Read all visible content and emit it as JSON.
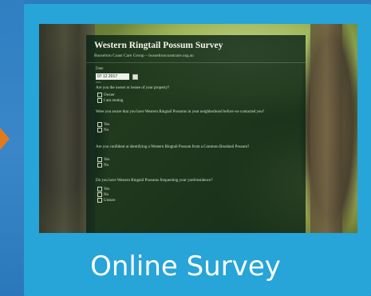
{
  "form": {
    "title": "Western Ringtail Possum Survey",
    "subtitle": "Busselton Coast Care Group – busseltoncoastcare.org.au",
    "date_label": "Date",
    "date_value": "07 12 2017",
    "date_hint": "Date",
    "questions": [
      {
        "text": "Are you the owner or lessee of your property?",
        "options": [
          "Owner",
          "I am renting"
        ]
      },
      {
        "text": "Were you aware that you have Western Ringtail Possums in your neighborhood before we contacted you?",
        "options": [
          "Yes",
          "No"
        ]
      },
      {
        "text": "Are you confident at identifying a Western Ringtail Possum from a Common Brushtail Possum?",
        "options": [
          "Yes",
          "No"
        ]
      },
      {
        "text": "Do you have Western Ringtail Possums frequenting your yard/residence?",
        "options": [
          "Yes",
          "No",
          "Unsure"
        ]
      }
    ]
  },
  "caption": "Online Survey",
  "colors": {
    "card": "#27a4d8",
    "background": "#2a7dc0",
    "form_bg": "#0a2316",
    "accent_arrow": "#e27a1e"
  }
}
